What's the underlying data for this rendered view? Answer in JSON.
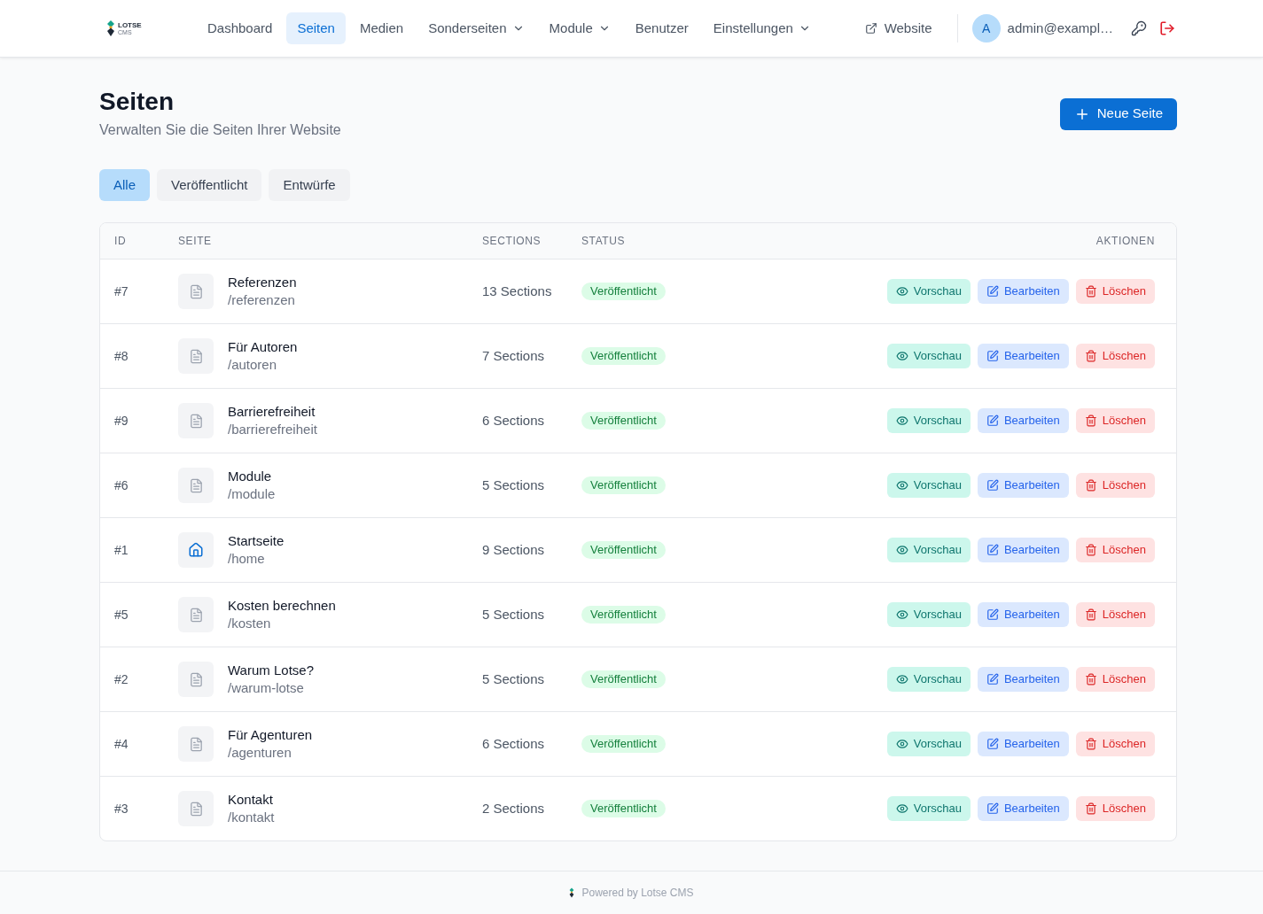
{
  "header": {
    "logo": {
      "name": "LOTSE",
      "sub": "CMS"
    },
    "nav": [
      {
        "label": "Dashboard",
        "selected": false,
        "dropdown": false
      },
      {
        "label": "Seiten",
        "selected": true,
        "dropdown": false
      },
      {
        "label": "Medien",
        "selected": false,
        "dropdown": false
      },
      {
        "label": "Sonderseiten",
        "selected": false,
        "dropdown": true
      },
      {
        "label": "Module",
        "selected": false,
        "dropdown": true
      },
      {
        "label": "Benutzer",
        "selected": false,
        "dropdown": false
      },
      {
        "label": "Einstellungen",
        "selected": false,
        "dropdown": true
      }
    ],
    "website_link": "Website",
    "user": {
      "initial": "A",
      "email": "admin@exampl…"
    }
  },
  "page": {
    "title": "Seiten",
    "subtitle": "Verwalten Sie die Seiten Ihrer Website",
    "new_button": "Neue Seite"
  },
  "filters": [
    {
      "label": "Alle",
      "selected": true
    },
    {
      "label": "Veröffentlicht",
      "selected": false
    },
    {
      "label": "Entwürfe",
      "selected": false
    }
  ],
  "table": {
    "columns": [
      "ID",
      "SEITE",
      "SECTIONS",
      "STATUS",
      "AKTIONEN"
    ],
    "rows": [
      {
        "id": "#7",
        "kind": "page",
        "title": "Referenzen",
        "slug": "/referenzen",
        "sections": "13 Sections",
        "status": {
          "kind": "published",
          "label": "Veröffentlicht"
        },
        "actions": [
          {
            "kind": "preview",
            "label": "Vorschau"
          },
          {
            "kind": "edit",
            "label": "Bearbeiten"
          },
          {
            "kind": "delete",
            "label": "Löschen"
          }
        ]
      },
      {
        "id": "#8",
        "kind": "page",
        "title": "Für Autoren",
        "slug": "/autoren",
        "sections": "7 Sections",
        "status": {
          "kind": "published",
          "label": "Veröffentlicht"
        },
        "actions": [
          {
            "kind": "preview",
            "label": "Vorschau"
          },
          {
            "kind": "edit",
            "label": "Bearbeiten"
          },
          {
            "kind": "delete",
            "label": "Löschen"
          }
        ]
      },
      {
        "id": "#9",
        "kind": "page",
        "title": "Barrierefreiheit",
        "slug": "/barrierefreiheit",
        "sections": "6 Sections",
        "status": {
          "kind": "published",
          "label": "Veröffentlicht"
        },
        "actions": [
          {
            "kind": "preview",
            "label": "Vorschau"
          },
          {
            "kind": "edit",
            "label": "Bearbeiten"
          },
          {
            "kind": "delete",
            "label": "Löschen"
          }
        ]
      },
      {
        "id": "#6",
        "kind": "page",
        "title": "Module",
        "slug": "/module",
        "sections": "5 Sections",
        "status": {
          "kind": "published",
          "label": "Veröffentlicht"
        },
        "actions": [
          {
            "kind": "preview",
            "label": "Vorschau"
          },
          {
            "kind": "edit",
            "label": "Bearbeiten"
          },
          {
            "kind": "delete",
            "label": "Löschen"
          }
        ]
      },
      {
        "id": "#1",
        "kind": "home",
        "title": "Startseite",
        "slug": "/home",
        "sections": "9 Sections",
        "status": {
          "kind": "published",
          "label": "Veröffentlicht"
        },
        "actions": [
          {
            "kind": "preview",
            "label": "Vorschau"
          },
          {
            "kind": "edit",
            "label": "Bearbeiten"
          },
          {
            "kind": "delete",
            "label": "Löschen"
          }
        ]
      },
      {
        "id": "#5",
        "kind": "page",
        "title": "Kosten berechnen",
        "slug": "/kosten",
        "sections": "5 Sections",
        "status": {
          "kind": "published",
          "label": "Veröffentlicht"
        },
        "actions": [
          {
            "kind": "preview",
            "label": "Vorschau"
          },
          {
            "kind": "edit",
            "label": "Bearbeiten"
          },
          {
            "kind": "delete",
            "label": "Löschen"
          }
        ]
      },
      {
        "id": "#2",
        "kind": "page",
        "title": "Warum Lotse?",
        "slug": "/warum-lotse",
        "sections": "5 Sections",
        "status": {
          "kind": "published",
          "label": "Veröffentlicht"
        },
        "actions": [
          {
            "kind": "preview",
            "label": "Vorschau"
          },
          {
            "kind": "edit",
            "label": "Bearbeiten"
          },
          {
            "kind": "delete",
            "label": "Löschen"
          }
        ]
      },
      {
        "id": "#4",
        "kind": "page",
        "title": "Für Agenturen",
        "slug": "/agenturen",
        "sections": "6 Sections",
        "status": {
          "kind": "published",
          "label": "Veröffentlicht"
        },
        "actions": [
          {
            "kind": "preview",
            "label": "Vorschau"
          },
          {
            "kind": "edit",
            "label": "Bearbeiten"
          },
          {
            "kind": "delete",
            "label": "Löschen"
          }
        ]
      },
      {
        "id": "#3",
        "kind": "page",
        "title": "Kontakt",
        "slug": "/kontakt",
        "sections": "2 Sections",
        "status": {
          "kind": "published",
          "label": "Veröffentlicht"
        },
        "actions": [
          {
            "kind": "preview",
            "label": "Vorschau"
          },
          {
            "kind": "edit",
            "label": "Bearbeiten"
          },
          {
            "kind": "delete",
            "label": "Löschen"
          }
        ]
      }
    ]
  },
  "footer": {
    "text": "Powered by Lotse CMS"
  }
}
